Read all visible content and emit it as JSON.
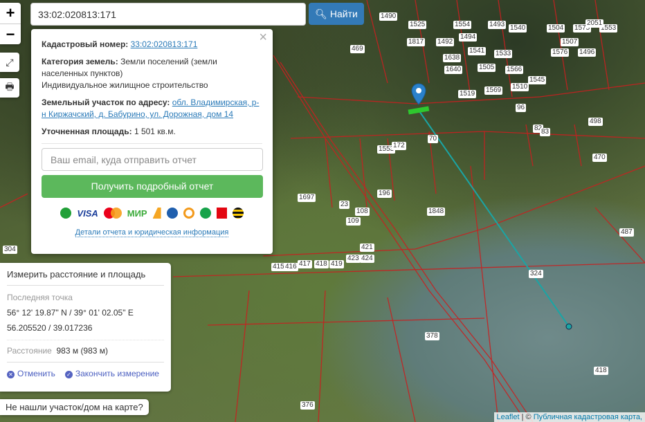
{
  "search": {
    "value": "33:02:020813:171",
    "button": "Найти"
  },
  "zoom": {
    "in": "+",
    "out": "−"
  },
  "popup": {
    "cad_label": "Кадастровый номер:",
    "cad_value": "33:02:020813:171",
    "cat_label": "Категория земель:",
    "cat_value": "Земли поселений (земли населенных пунктов)",
    "use": "Индивидуальное жилищное строительство",
    "addr_label": "Земельный участок по адресу:",
    "addr_value": "обл. Владимирская, р-н Киржачский, д. Бабурино, ул. Дорожная, дом 14",
    "area_label": "Уточненная площадь:",
    "area_value": "1 501 кв.м.",
    "email_placeholder": "Ваш email, куда отправить отчет",
    "report_button": "Получить подробный отчет",
    "visa": "VISA",
    "mir": "МИР",
    "details_link": "Детали отчета и юридическая информация"
  },
  "measure": {
    "title": "Измерить расстояние и площадь",
    "last_point_label": "Последняя точка",
    "dms": "56° 12' 19.87\" N / 39° 01' 02.05\" E",
    "decimal": "56.205520 / 39.017236",
    "distance_label": "Расстояние",
    "distance_value": "983 м (983 м)",
    "cancel": "Отменить",
    "finish": "Закончить измерение"
  },
  "not_found": "Не нашли участок/дом на карте?",
  "attribution": {
    "leaflet": "Leaflet",
    "sep": " | © ",
    "source": "Публичная кадастровая карта,"
  },
  "parcels": [
    "1490",
    "1525",
    "1554",
    "1493",
    "1540",
    "1504",
    "1575",
    "1553",
    "2051",
    "469",
    "1817",
    "1492",
    "1494",
    "1541",
    "1533",
    "1566",
    "1545",
    "1496",
    "1576",
    "1507",
    "1638",
    "1640",
    "1505",
    "1510",
    "1569",
    "1519",
    "96",
    "498",
    "82",
    "83",
    "70",
    "1553",
    "172",
    "1697",
    "23",
    "108",
    "109",
    "196",
    "1848",
    "470",
    "421",
    "423",
    "424",
    "415",
    "416",
    "417",
    "418",
    "419",
    "324",
    "378",
    "418",
    "376",
    "487",
    "304"
  ]
}
